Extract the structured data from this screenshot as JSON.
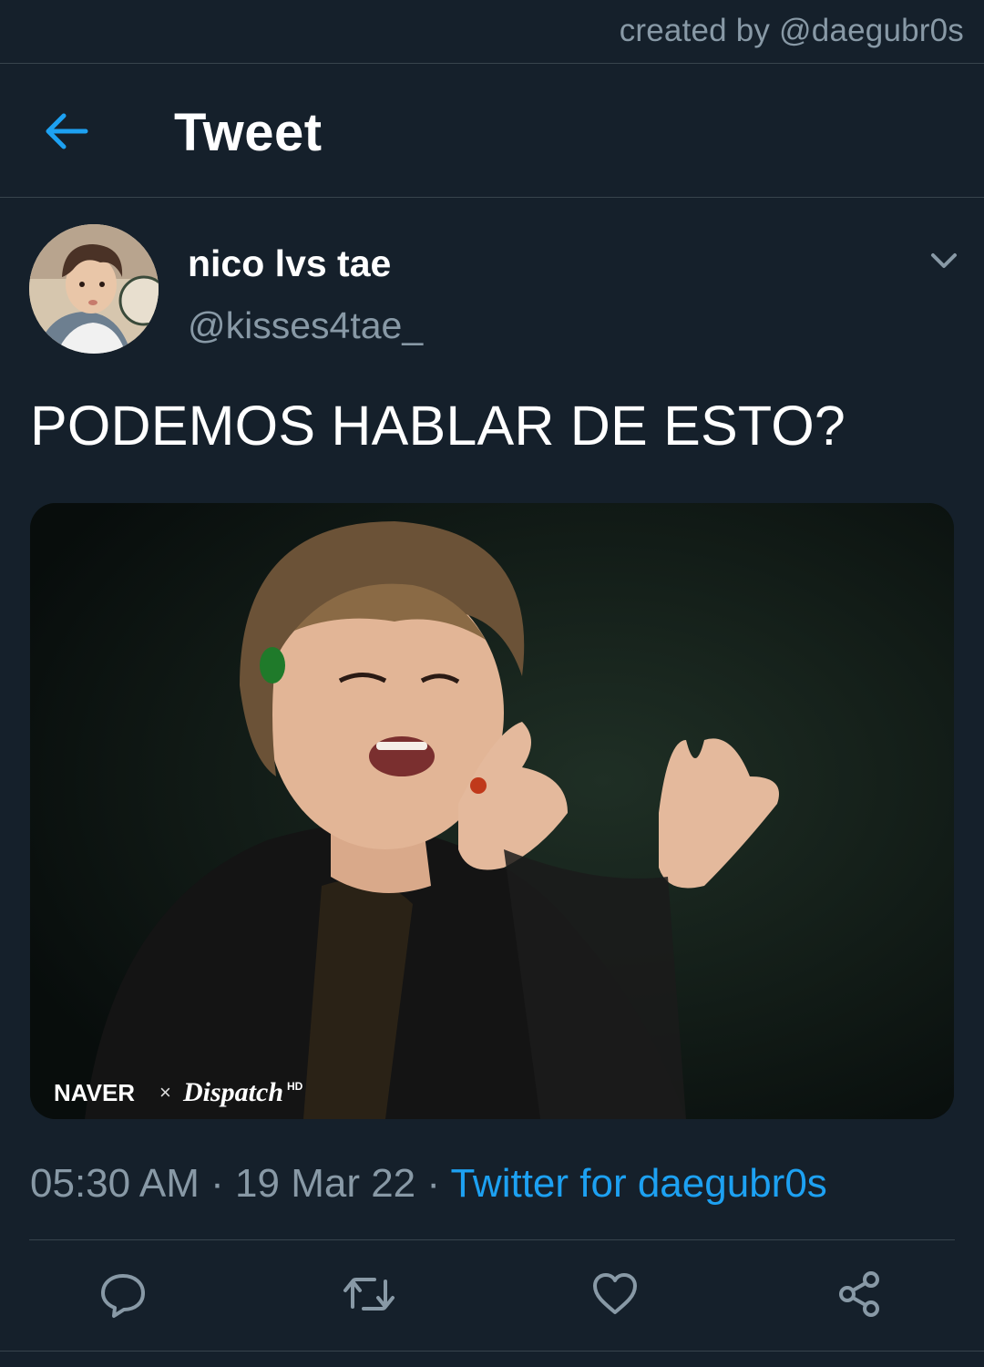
{
  "credit": "created by @daegubr0s",
  "header": {
    "title": "Tweet",
    "back_icon": "arrow-left-icon"
  },
  "tweet": {
    "display_name": "nico lvs tae",
    "handle": "@kisses4tae_",
    "text": "PODEMOS HABLAR DE ESTO?",
    "media": {
      "watermark_left": "NAVER",
      "watermark_sep": "×",
      "watermark_right": "Dispatch",
      "watermark_hd": "HD"
    },
    "time": "05:30 AM",
    "separator": "·",
    "date": "19 Mar 22",
    "source": "Twitter for daegubr0s"
  },
  "actions": [
    "reply-icon",
    "retweet-icon",
    "like-icon",
    "share-icon"
  ],
  "colors": {
    "background": "#15202b",
    "divider": "#38444d",
    "secondary_text": "#8899a6",
    "accent": "#1da1f2"
  }
}
